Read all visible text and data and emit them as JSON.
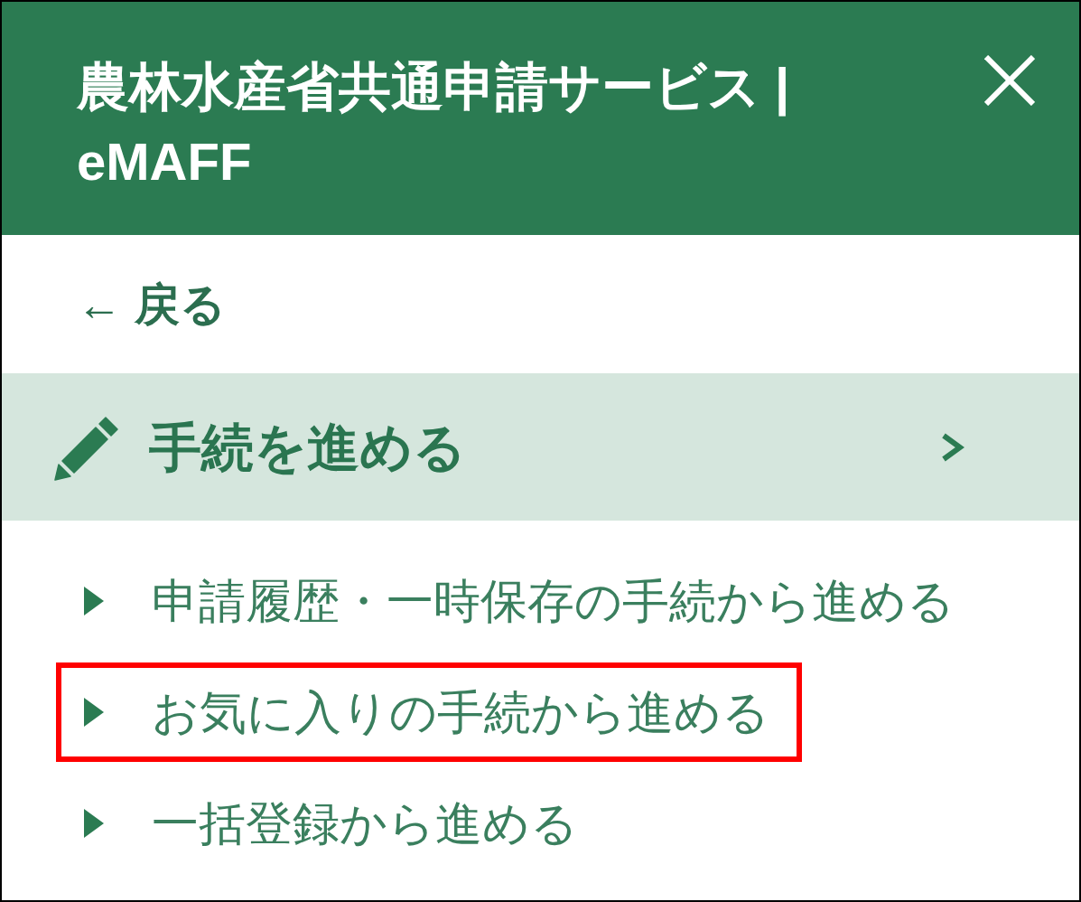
{
  "header": {
    "title": "農林水産省共通申請サービス | eMAFF"
  },
  "back_link": {
    "label": "← 戻る"
  },
  "section": {
    "label": "手続を進める",
    "selected": true
  },
  "items": [
    {
      "label": "申請履歴・一時保存の手続から進める",
      "highlighted": false
    },
    {
      "label": "お気に入りの手続から進める",
      "highlighted": true
    },
    {
      "label": "一括登録から進める",
      "highlighted": false
    }
  ]
}
